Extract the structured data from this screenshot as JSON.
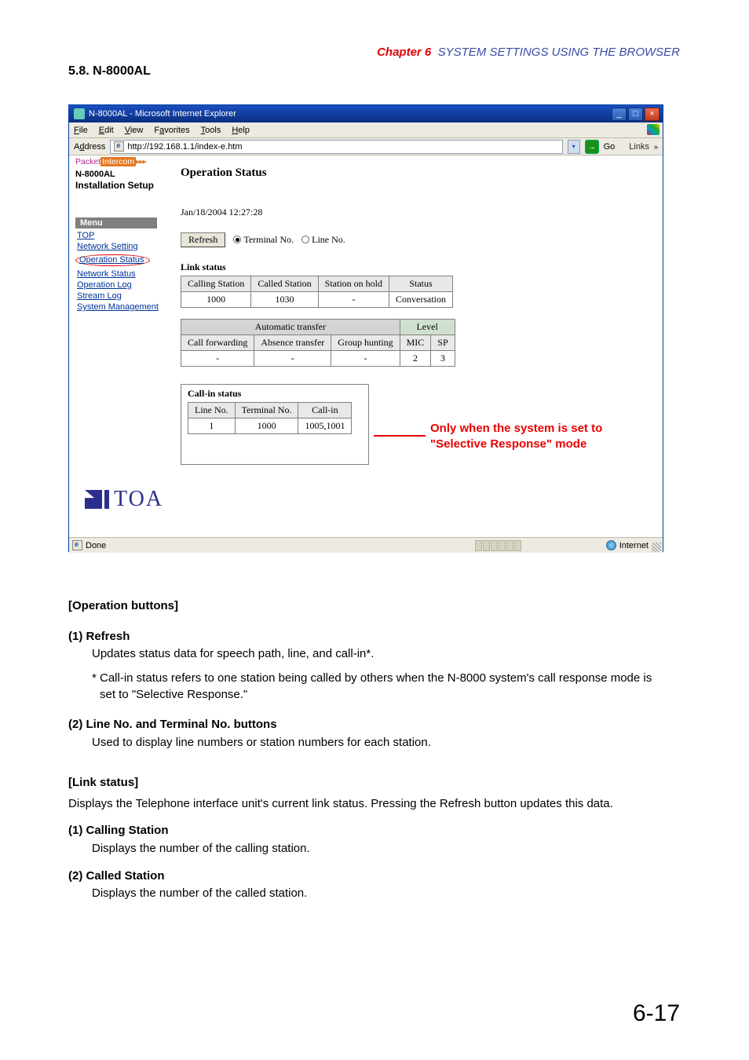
{
  "header": {
    "chapter_label": "Chapter 6",
    "chapter_title": "SYSTEM SETTINGS USING THE BROWSER"
  },
  "section": {
    "number_title": "5.8. N-8000AL"
  },
  "browser": {
    "window_title": "N-8000AL - Microsoft Internet Explorer",
    "menus": {
      "file": "File",
      "edit": "Edit",
      "view": "View",
      "favorites": "Favorites",
      "tools": "Tools",
      "help": "Help"
    },
    "address_label": "Address",
    "address_value": "http://192.168.1.1/index-e.htm",
    "go_label": "Go",
    "links_label": "Links",
    "status_done": "Done",
    "zone_label": "Internet"
  },
  "sidebar": {
    "packet": "Packet",
    "intercom": "Intercom",
    "model": "N-8000AL",
    "install": "Installation Setup",
    "menu_header": "Menu",
    "items": {
      "top": "TOP",
      "network_setting": "Network Setting",
      "operation_status": "Operation Status",
      "network_status": "Network Status",
      "operation_log": "Operation Log",
      "stream_log": "Stream Log",
      "system_management": "System Management"
    },
    "logo_text": "TOA"
  },
  "main": {
    "heading": "Operation Status",
    "timestamp": "Jan/18/2004 12:27:28",
    "refresh_btn": "Refresh",
    "radio_terminal": "Terminal No.",
    "radio_line": "Line No.",
    "link_heading": "Link status",
    "link_headers": {
      "calling": "Calling Station",
      "called": "Called Station",
      "hold": "Station on hold",
      "status": "Status"
    },
    "link_row": {
      "calling": "1000",
      "called": "1030",
      "hold": "-",
      "status": "Conversation"
    },
    "auto_header": "Automatic transfer",
    "level_header": "Level",
    "auto_cols": {
      "cfwd": "Call forwarding",
      "abs": "Absence transfer",
      "grp": "Group hunting",
      "mic": "MIC",
      "sp": "SP"
    },
    "auto_row": {
      "cfwd": "-",
      "abs": "-",
      "grp": "-",
      "mic": "2",
      "sp": "3"
    },
    "callin_heading": "Call-in status",
    "callin_headers": {
      "line": "Line No.",
      "term": "Terminal No.",
      "callin": "Call-in"
    },
    "callin_row": {
      "line": "1",
      "term": "1000",
      "callin": "1005,1001"
    }
  },
  "annotation": {
    "line1": "Only when the system is set to",
    "line2": "\"Selective Response\" mode"
  },
  "body": {
    "ops_head": "[Operation buttons]",
    "b1_head": "(1)  Refresh",
    "b1_text": "Updates status data for speech path, line, and call-in*.",
    "b1_note": "* Call-in status refers to one station being called by others when the N-8000 system's call response mode is set to \"Selective Response.\"",
    "b2_head": "(2)  Line No. and Terminal No. buttons",
    "b2_text": "Used to display line numbers or station numbers for each station.",
    "link_head": "[Link status]",
    "link_text": "Displays the Telephone interface unit's current link status. Pressing the Refresh button updates this data.",
    "l1_head": "(1)  Calling Station",
    "l1_text": "Displays the number of the calling station.",
    "l2_head": "(2)  Called Station",
    "l2_text": "Displays the number of the called station."
  },
  "page_number": "6-17"
}
